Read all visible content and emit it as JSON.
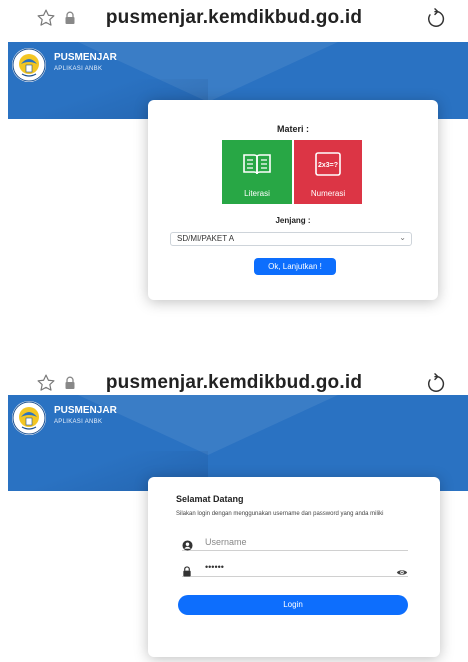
{
  "screen1": {
    "url": "pusmenjar.kemdikbud.go.id",
    "brand": {
      "title": "PUSMENJAR",
      "subtitle": "APLIKASI ANBK"
    },
    "materi_heading": "Materi :",
    "tiles": [
      {
        "label": "Literasi",
        "icon": "book-icon",
        "color": "#28a745"
      },
      {
        "label": "Numerasi",
        "icon": "math-formula-icon",
        "color": "#dc3545"
      }
    ],
    "jenjang_heading": "Jenjang :",
    "jenjang_select": {
      "value": "SD/MI/PAKET A"
    },
    "ok_button": "Ok, Lanjutkan !"
  },
  "screen2": {
    "url": "pusmenjar.kemdikbud.go.id",
    "brand": {
      "title": "PUSMENJAR",
      "subtitle": "APLIKASI ANBK"
    },
    "welcome": "Selamat Datang",
    "instructions": "Silakan login dengan menggunakan username dan password yang anda miliki",
    "username": {
      "placeholder": "Username",
      "icon": "user-icon"
    },
    "password": {
      "value": "••••••",
      "icon": "lock-icon",
      "toggle_icon": "eye-icon"
    },
    "login_button": "Login"
  },
  "colors": {
    "banner": "#2a72c2",
    "primary": "#0d6efd",
    "green": "#28a745",
    "red": "#dc3545"
  }
}
